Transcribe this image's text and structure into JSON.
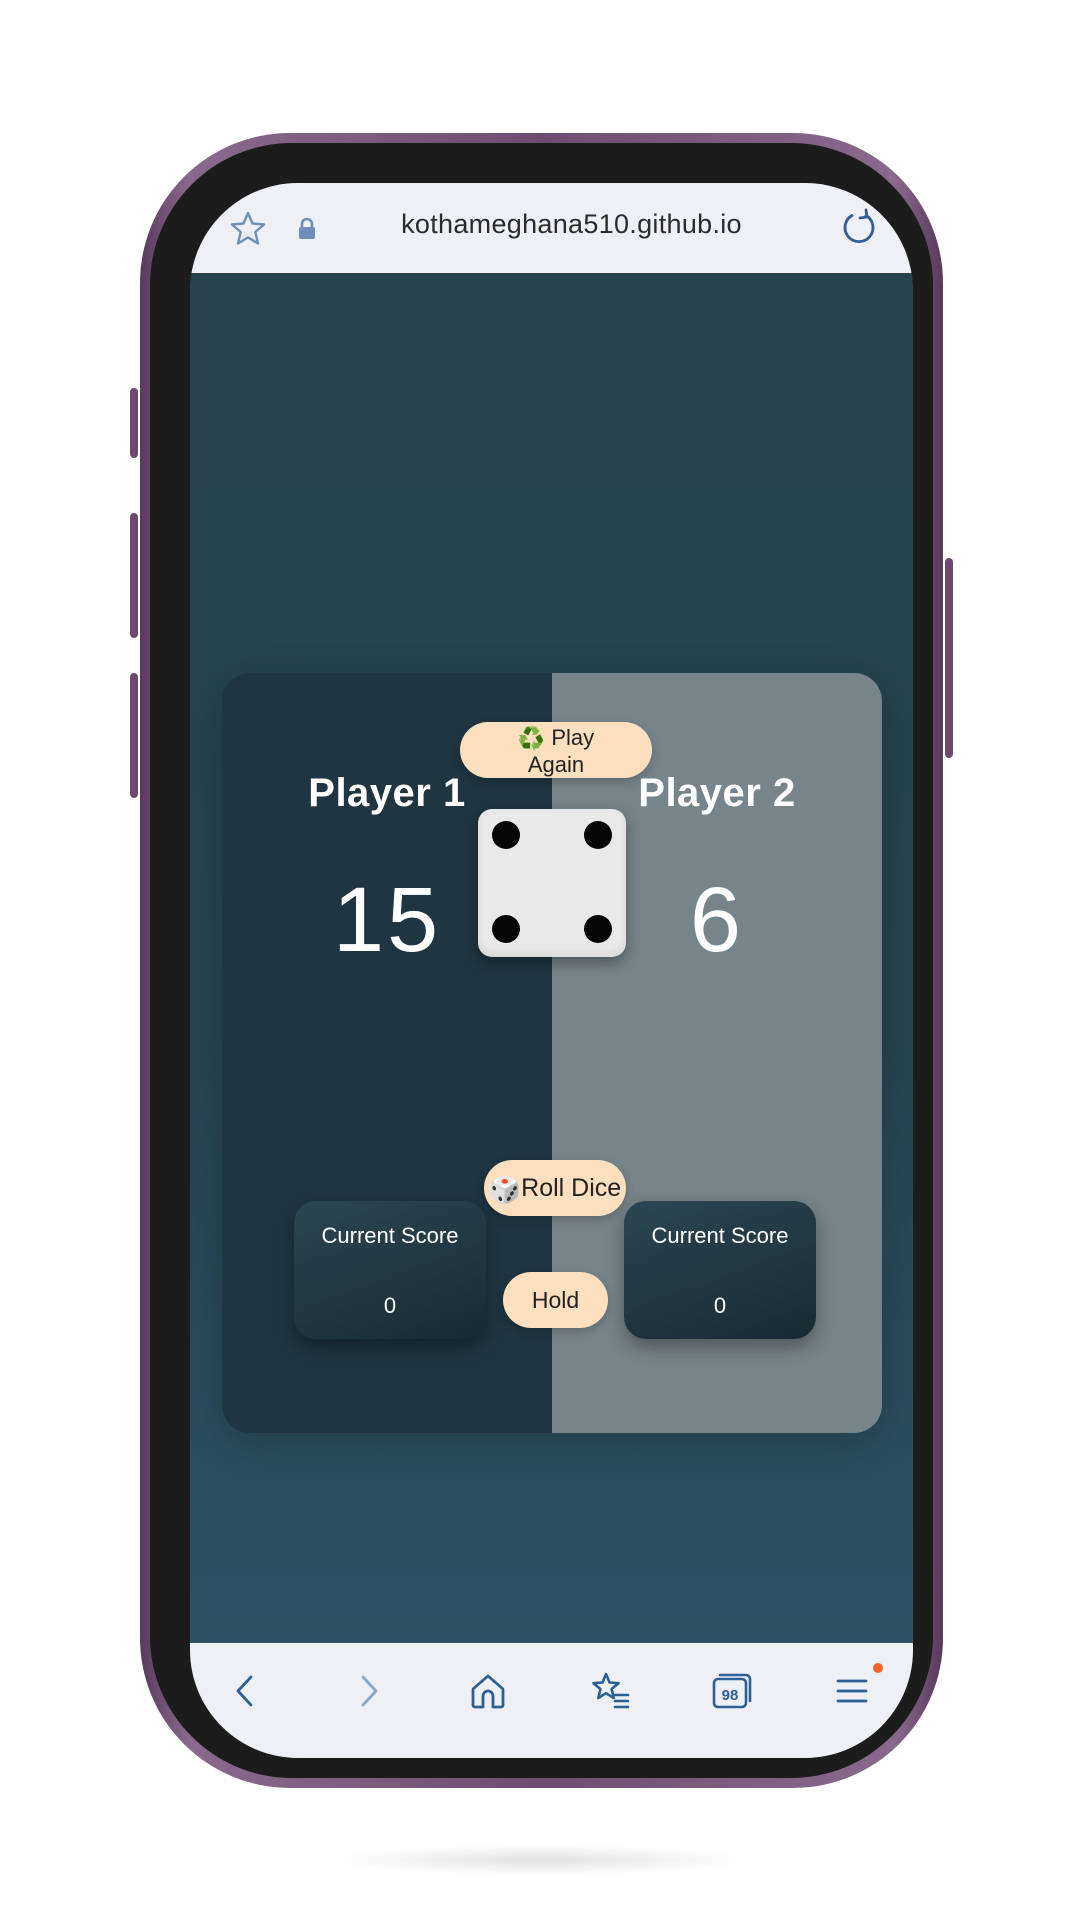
{
  "browser": {
    "url": "kothameghana510.github.io",
    "tabs_count": "98",
    "icons": {
      "bookmark": "star-icon",
      "lock": "lock-icon",
      "reload": "reload-icon",
      "back": "back-icon",
      "forward": "forward-icon",
      "home": "home-icon",
      "bookmarks": "bookmarks-icon",
      "tabs": "tabs-icon",
      "menu": "menu-icon"
    }
  },
  "game": {
    "play_again": {
      "emoji": "♻️",
      "label_line1": "Play",
      "label_line2": "Again"
    },
    "roll": {
      "emoji": "🎲",
      "label": "Roll Dice"
    },
    "hold": {
      "label": "Hold"
    },
    "dice_value": 4,
    "players": [
      {
        "name": "Player 1",
        "score": "15",
        "current_label": "Current Score",
        "current": "0",
        "active": true
      },
      {
        "name": "Player 2",
        "score": "6",
        "current_label": "Current Score",
        "current": "0",
        "active": false
      }
    ]
  },
  "colors": {
    "page_bg": "#284753",
    "active_panel": "#1f3541",
    "inactive_panel": "#76858b",
    "button": "#fcdfbe",
    "phone_frame": "#6d4e70",
    "notification_dot": "#f0652a"
  }
}
